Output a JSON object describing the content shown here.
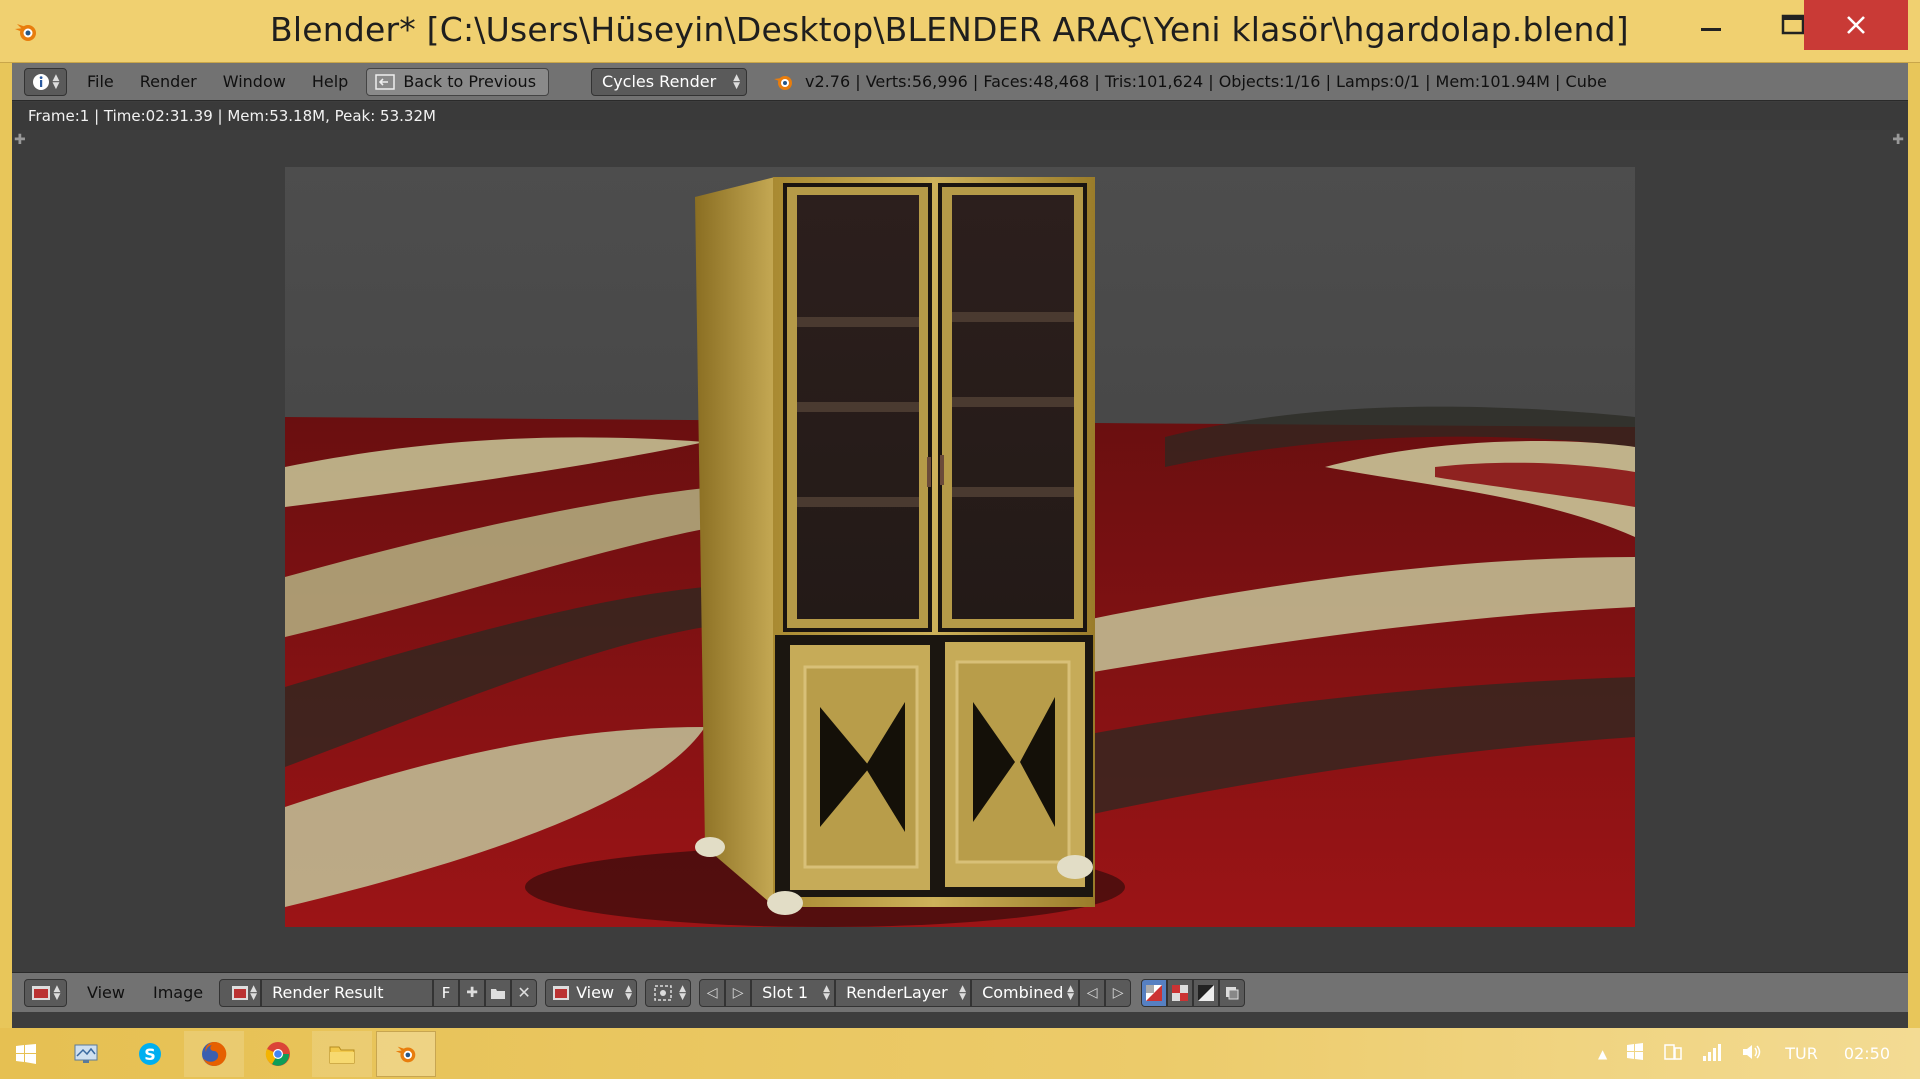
{
  "window": {
    "title": "Blender* [C:\\Users\\Hüseyin\\Desktop\\BLENDER ARAÇ\\Yeni klasör\\hgardolap.blend]"
  },
  "info_header": {
    "menus": [
      "File",
      "Render",
      "Window",
      "Help"
    ],
    "back_button": "Back to Previous",
    "render_engine": "Cycles Render",
    "stats": "v2.76 | Verts:56,996 | Faces:48,468 | Tris:101,624 | Objects:1/16 | Lamps:0/1 | Mem:101.94M | Cube"
  },
  "render_status": "Frame:1 | Time:02:31.39 | Mem:53.18M, Peak: 53.32M",
  "image_header": {
    "view_menu": "View",
    "image_menu": "Image",
    "image_name": "Render Result",
    "fake_user": "F",
    "view_dropdown": "View",
    "slot": "Slot 1",
    "render_layer": "RenderLayer",
    "pass": "Combined"
  },
  "taskbar": {
    "language": "TUR",
    "clock": "02:50"
  },
  "colors": {
    "accent": "#f0d070",
    "close": "#c93a36",
    "blender_header": "#727272",
    "blender_bg": "#3d3d3d"
  },
  "icons": [
    "blender-icon",
    "minimize-icon",
    "maximize-icon",
    "close-icon",
    "info-icon",
    "back-icon",
    "blender-logo-icon",
    "image-editor-icon",
    "image-icon",
    "new-image-icon",
    "open-image-icon",
    "unlink-icon",
    "view-icon",
    "zoom-icon",
    "prev-icon",
    "next-icon",
    "alpha-icon",
    "checker-icon",
    "curve-icon",
    "clone-icon",
    "windows-icon",
    "desktop-icon",
    "skype-icon",
    "firefox-icon",
    "chrome-icon",
    "folder-icon",
    "tray-up-icon",
    "flag-icon",
    "devices-icon",
    "network-icon",
    "volume-icon"
  ]
}
